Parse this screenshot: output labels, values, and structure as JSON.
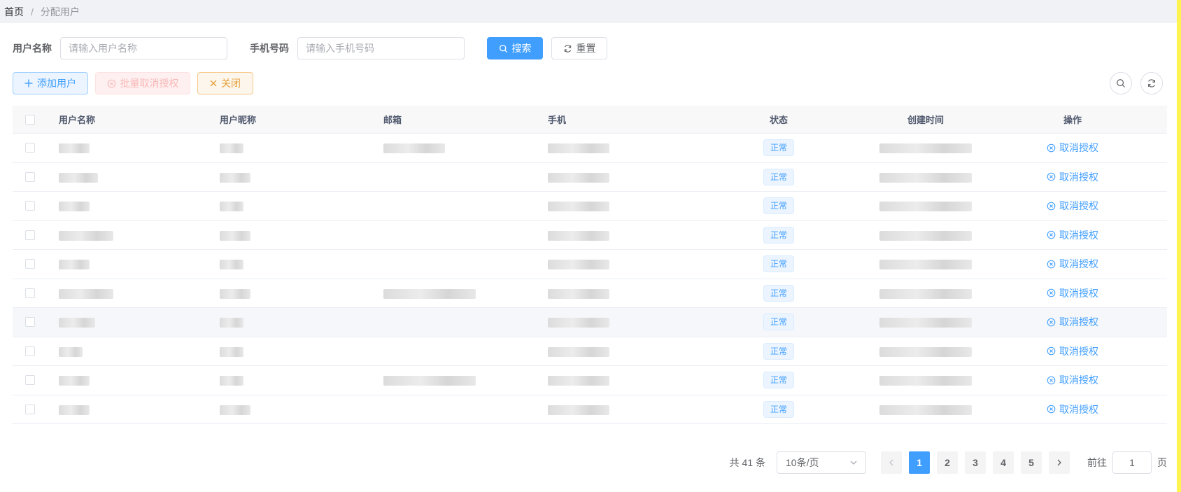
{
  "breadcrumb": {
    "home": "首页",
    "separator": "/",
    "current": "分配用户"
  },
  "search": {
    "username_label": "用户名称",
    "username_placeholder": "请输入用户名称",
    "username_value": "",
    "phone_label": "手机号码",
    "phone_placeholder": "请输入手机号码",
    "phone_value": "",
    "search_button": "搜索",
    "reset_button": "重置"
  },
  "toolbar": {
    "add_user": "添加用户",
    "batch_revoke": "批量取消授权",
    "close": "关闭"
  },
  "table": {
    "headers": {
      "username": "用户名称",
      "nickname": "用户昵称",
      "email": "邮箱",
      "phone": "手机",
      "status": "状态",
      "created_at": "创建时间",
      "operation": "操作"
    },
    "rows": [
      {
        "status": "正常",
        "action": "取消授权"
      },
      {
        "status": "正常",
        "action": "取消授权"
      },
      {
        "status": "正常",
        "action": "取消授权"
      },
      {
        "status": "正常",
        "action": "取消授权"
      },
      {
        "status": "正常",
        "action": "取消授权"
      },
      {
        "status": "正常",
        "action": "取消授权"
      },
      {
        "status": "正常",
        "action": "取消授权"
      },
      {
        "status": "正常",
        "action": "取消授权"
      },
      {
        "status": "正常",
        "action": "取消授权"
      },
      {
        "status": "正常",
        "action": "取消授权"
      }
    ]
  },
  "pagination": {
    "total": "共 41 条",
    "page_size": "10条/页",
    "pages": [
      "1",
      "2",
      "3",
      "4",
      "5"
    ],
    "current_page": "1",
    "jump_prefix": "前往",
    "jump_value": "1",
    "jump_suffix": "页"
  },
  "colors": {
    "primary": "#409eff",
    "warning": "#e6a23c",
    "danger_light": "#f9b7b7",
    "edge": "#fff44f"
  }
}
